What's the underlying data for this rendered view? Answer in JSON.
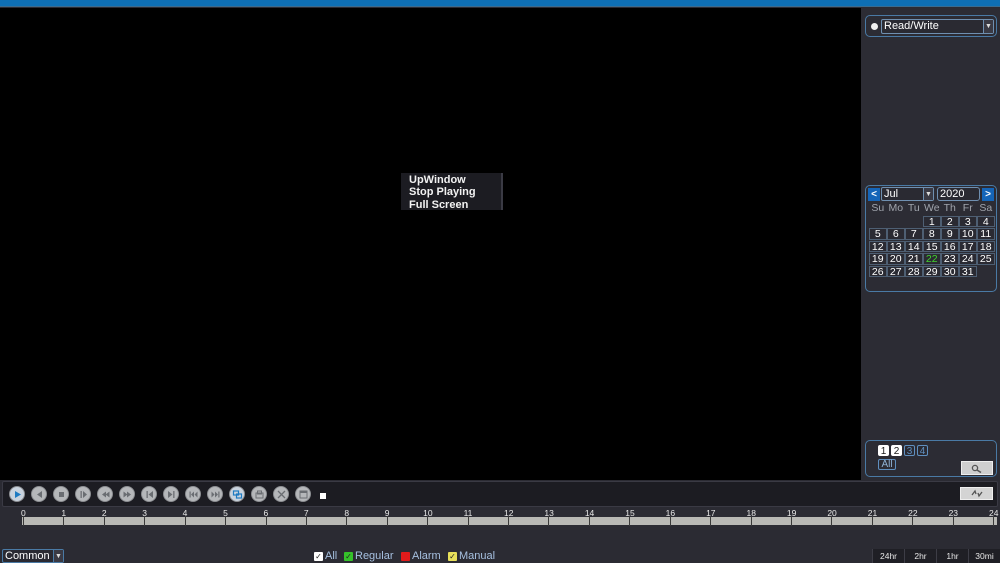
{
  "top_bar": {
    "color": "#0e6fb4"
  },
  "context_menu": {
    "items": [
      "UpWindow",
      "Stop Playing",
      "Full Screen"
    ]
  },
  "sidebar": {
    "access_mode": {
      "selected": "Read/Write"
    },
    "calendar": {
      "prev_label": "<",
      "next_label": ">",
      "month": "Jul",
      "year": "2020",
      "weekdays": [
        "Su",
        "Mo",
        "Tu",
        "We",
        "Th",
        "Fr",
        "Sa"
      ],
      "first_weekday_index": 3,
      "days_in_month": 31,
      "today": 22,
      "today_color": "#41d22f"
    },
    "channels": {
      "buttons": [
        {
          "label": "1",
          "selected": true
        },
        {
          "label": "2",
          "selected": true
        },
        {
          "label": "3",
          "selected": false
        },
        {
          "label": "4",
          "selected": false
        }
      ],
      "all_label": "All",
      "search_icon": "magnifier-icon"
    }
  },
  "playback_controls": {
    "buttons": [
      {
        "name": "play",
        "icon": "play-icon",
        "active": true
      },
      {
        "name": "reverse-play",
        "icon": "reverse-play-icon",
        "active": false
      },
      {
        "name": "stop",
        "icon": "stop-icon",
        "active": false
      },
      {
        "name": "step-forward",
        "icon": "step-forward-icon",
        "active": false
      },
      {
        "name": "slow",
        "icon": "rewind-icon",
        "active": false
      },
      {
        "name": "fast",
        "icon": "fast-forward-icon",
        "active": false
      },
      {
        "name": "previous-frame",
        "icon": "previous-frame-icon",
        "active": false
      },
      {
        "name": "next-frame",
        "icon": "next-frame-icon",
        "active": false
      },
      {
        "name": "previous-file",
        "icon": "skip-back-icon",
        "active": false
      },
      {
        "name": "next-file",
        "icon": "skip-forward-icon",
        "active": false
      },
      {
        "name": "sync-play",
        "icon": "sync-icon",
        "active": true
      },
      {
        "name": "clip",
        "icon": "clip-icon",
        "active": false
      },
      {
        "name": "cut",
        "icon": "scissors-icon",
        "active": false
      },
      {
        "name": "backup",
        "icon": "window-icon",
        "active": false
      }
    ],
    "sync_button_icon": "refresh-icon"
  },
  "timeline": {
    "hours": [
      "0",
      "1",
      "2",
      "3",
      "4",
      "5",
      "6",
      "7",
      "8",
      "9",
      "10",
      "11",
      "12",
      "13",
      "14",
      "15",
      "16",
      "17",
      "18",
      "19",
      "20",
      "21",
      "22",
      "23",
      "24"
    ]
  },
  "record_type": {
    "selected": "Common I"
  },
  "legend": [
    {
      "label": "All",
      "color": "#ffffff",
      "checked": true
    },
    {
      "label": "Regular",
      "color": "#35c12a",
      "checked": true
    },
    {
      "label": "Alarm",
      "color": "#e01b1b",
      "checked": false
    },
    {
      "label": "Manual",
      "color": "#e8e05a",
      "checked": true
    }
  ],
  "zoom_tabs": [
    "24hr",
    "2hr",
    "1hr",
    "30mi"
  ]
}
